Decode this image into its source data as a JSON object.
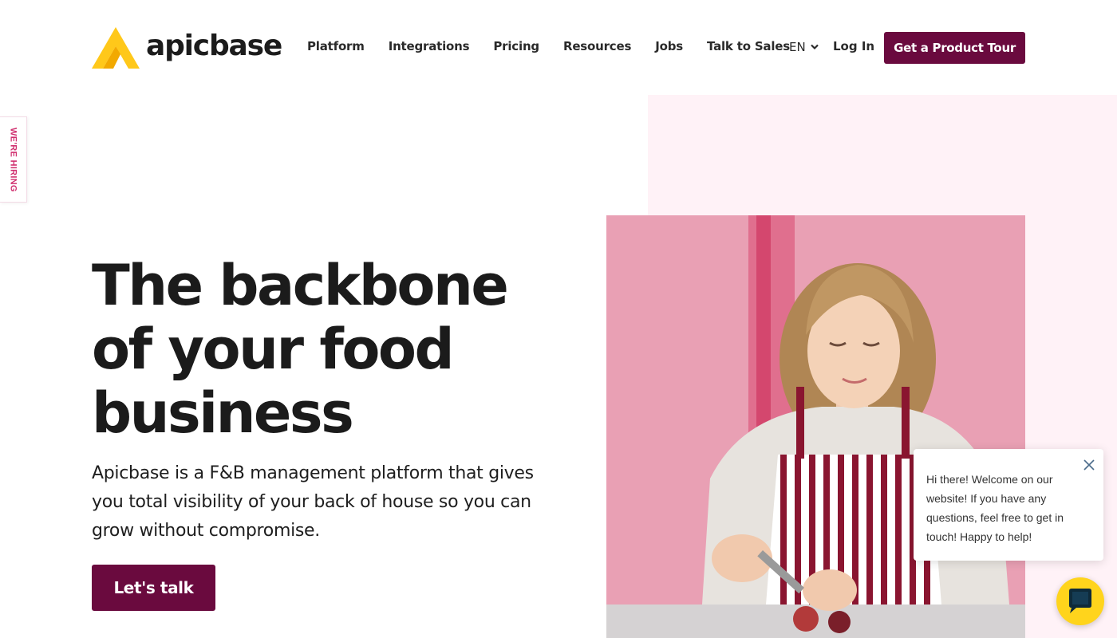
{
  "brand": {
    "name": "apicbase",
    "logo_color": "#ffcc1a",
    "accent": "#6a0a3e"
  },
  "nav": {
    "items": [
      "Platform",
      "Integrations",
      "Pricing",
      "Resources",
      "Jobs",
      "Talk to Sales"
    ],
    "language": "EN",
    "login": "Log In",
    "tour_button": "Get a Product Tour"
  },
  "hiring_tab": "WE'RE HIRING",
  "hero": {
    "headline": [
      "The backbone",
      "of your food",
      "business"
    ],
    "subtext": "Apicbase is a F&B management platform that gives you total visibility of your back of house so you can grow without compromise.",
    "cta": "Let's talk"
  },
  "chat": {
    "message": "Hi there! Welcome on our website! If you have any questions, feel free to get in touch! Happy to help!",
    "launcher_color": "#ffd41c"
  }
}
